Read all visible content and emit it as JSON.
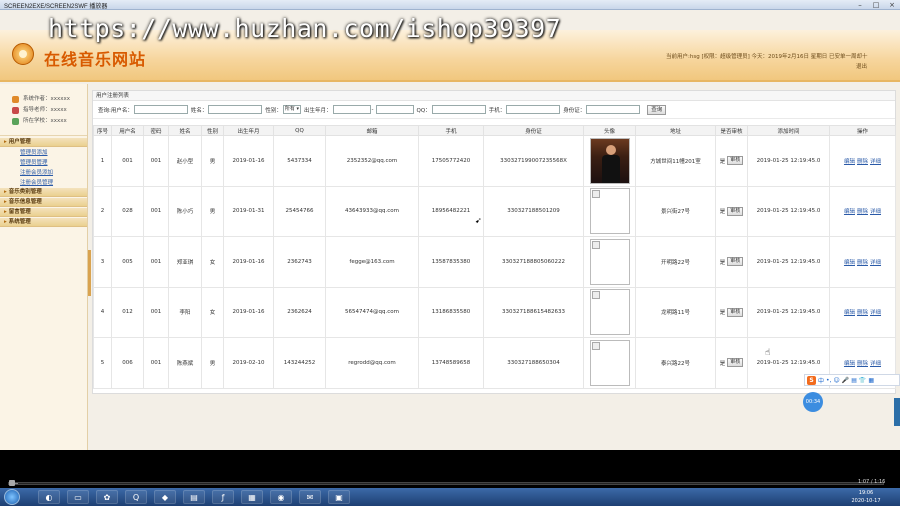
{
  "window": {
    "title": "SCREEN2EXE/SCREEN2SWF 播放器",
    "controls": [
      "–",
      "□",
      "×"
    ]
  },
  "watermark": "https://www.huzhan.com/ishop39397",
  "header": {
    "site_title": "在线音乐网站",
    "user_line1": "当前用户:hsg [权限：超级管理员]  今天：2019年2月16日 星期日 已安单一周却十",
    "user_line2": "退出"
  },
  "sidebar": {
    "info": [
      {
        "label": "系统作者：xxxxxx",
        "icon_color": "#e08a2a"
      },
      {
        "label": "指导老师：xxxxx",
        "icon_color": "#c84a4a"
      },
      {
        "label": "所在学校：xxxxx",
        "icon_color": "#5aa35a"
      }
    ],
    "groups": [
      {
        "label": "用户管理",
        "items": [
          "管理员添加",
          "管理员管理",
          "注册会员添加",
          "注册会员管理"
        ]
      },
      {
        "label": "音乐类别管理",
        "items": []
      },
      {
        "label": "音乐信息管理",
        "items": []
      },
      {
        "label": "留言管理",
        "items": []
      },
      {
        "label": "系统管理",
        "items": []
      }
    ]
  },
  "panel": {
    "title": "用户注册列表"
  },
  "search": {
    "username_label": "查询:用户名：",
    "name_label": "姓名：",
    "gender_label": "性别：",
    "gender_value": "所有 ▾",
    "birth_label": "出生年月：",
    "birth_sep": "-",
    "qq_label": "QQ：",
    "phone_label": "手机：",
    "id_label": "身份证：",
    "button": "查询"
  },
  "table": {
    "headers": [
      "序号",
      "用户名",
      "密码",
      "姓名",
      "性别",
      "出生年月",
      "QQ",
      "邮箱",
      "手机",
      "身份证",
      "头像",
      "地址",
      "是否审核",
      "添加时间",
      "操作"
    ],
    "rows": [
      {
        "no": "1",
        "user": "001",
        "pwd": "001",
        "name": "赵小型",
        "sex": "男",
        "birth": "2019-01-16",
        "qq": "5437334",
        "email": "2352352@qq.com",
        "phone": "17505772420",
        "id": "330327199007235568X",
        "photo": "real",
        "addr": "方城世间11幢201室",
        "audit": "是",
        "audit_btn": "审核",
        "time": "2019-01-25 12:19:45.0",
        "ops": [
          "编辑",
          "删除",
          "详细"
        ]
      },
      {
        "no": "2",
        "user": "028",
        "pwd": "001",
        "name": "陈小巧",
        "sex": "男",
        "birth": "2019-01-31",
        "qq": "25454766",
        "email": "43643933@qq.com",
        "phone": "18956482221",
        "id": "330327188501209",
        "photo": "broken",
        "addr": "景兴街27号",
        "audit": "是",
        "audit_btn": "审核",
        "time": "2019-01-25 12:19:45.0",
        "ops": [
          "编辑",
          "删除",
          "详细"
        ]
      },
      {
        "no": "3",
        "user": "005",
        "pwd": "001",
        "name": "郑亚琪",
        "sex": "女",
        "birth": "2019-01-16",
        "qq": "2362743",
        "email": "fegge@163.com",
        "phone": "13587835380",
        "id": "330327188805060222",
        "photo": "broken",
        "addr": "开明路22号",
        "audit": "是",
        "audit_btn": "审核",
        "time": "2019-01-25 12:19:45.0",
        "ops": [
          "编辑",
          "删除",
          "详细"
        ]
      },
      {
        "no": "4",
        "user": "012",
        "pwd": "001",
        "name": "李阳",
        "sex": "女",
        "birth": "2019-01-16",
        "qq": "2362624",
        "email": "56547474@qq.com",
        "phone": "13186835580",
        "id": "330327188615482633",
        "photo": "broken",
        "addr": "龙明路11号",
        "audit": "是",
        "audit_btn": "审核",
        "time": "2019-01-25 12:19:45.0",
        "ops": [
          "编辑",
          "删除",
          "详细"
        ]
      },
      {
        "no": "5",
        "user": "006",
        "pwd": "001",
        "name": "陈燕斌",
        "sex": "男",
        "birth": "2019-02-10",
        "qq": "143244252",
        "email": "regrodd@qq.com",
        "phone": "13748589658",
        "id": "330327188650304",
        "photo": "broken",
        "addr": "泰兴路22号",
        "audit": "是",
        "audit_btn": "审核",
        "time": "2019-01-25 12:19:45.0",
        "ops": [
          "编辑",
          "删除",
          "详细"
        ]
      }
    ]
  },
  "ime": {
    "logo": "S",
    "items": [
      "中",
      "•,",
      "☺",
      "🎤",
      "▤",
      "👕",
      "▦"
    ]
  },
  "clock_bubble": "00:34",
  "player": {
    "time": "1:07 / 1:16",
    "progress": 0.01
  },
  "taskbar": {
    "apps": [
      "◐",
      "▭",
      "✿",
      "Q",
      "◆",
      "▤",
      "ƒ",
      "▦",
      "◉",
      "✉",
      "▣"
    ],
    "time": "19:06",
    "date": "2020-10-17"
  }
}
